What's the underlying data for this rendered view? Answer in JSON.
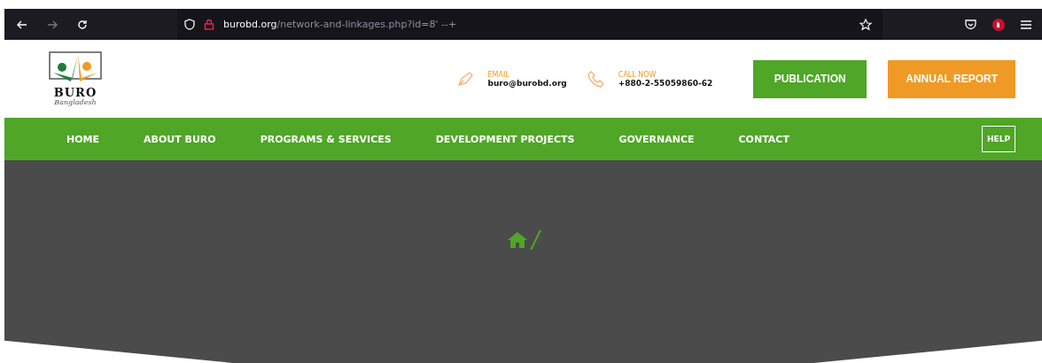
{
  "browser": {
    "url_host": "burobd.org",
    "url_path": "/network-and-linkages.php?id=8' --+"
  },
  "logo": {
    "name": "BURO",
    "tagline": "Bangladesh"
  },
  "contacts": [
    {
      "kind": "email",
      "label": "EMAIL",
      "value": "buro@burobd.org"
    },
    {
      "kind": "phone",
      "label": "CALL NOW",
      "value": "+880-2-55059860-62"
    }
  ],
  "header_buttons": [
    {
      "label": "PUBLICATION",
      "color": "#4fa627"
    },
    {
      "label": "ANNUAL REPORT",
      "color": "#ef9a24"
    }
  ],
  "nav": {
    "items": [
      "HOME",
      "ABOUT BURO",
      "PROGRAMS & SERVICES",
      "DEVELOPMENT PROJECTS",
      "GOVERNANCE",
      "CONTACT"
    ],
    "help": "HELP"
  },
  "breadcrumb": {
    "separator": "/"
  }
}
